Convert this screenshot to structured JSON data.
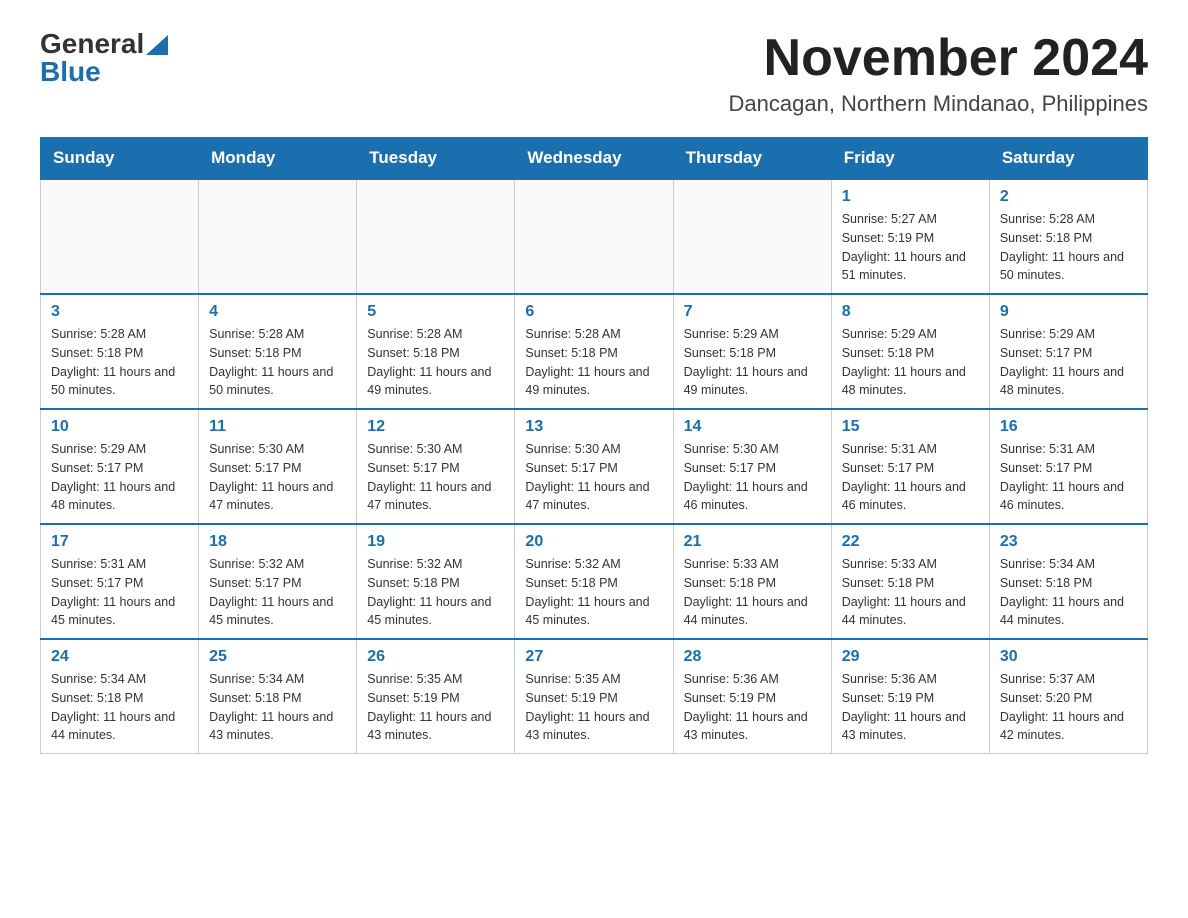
{
  "logo": {
    "general": "General",
    "blue": "Blue"
  },
  "title": {
    "month_year": "November 2024",
    "location": "Dancagan, Northern Mindanao, Philippines"
  },
  "days_of_week": [
    "Sunday",
    "Monday",
    "Tuesday",
    "Wednesday",
    "Thursday",
    "Friday",
    "Saturday"
  ],
  "weeks": [
    [
      {
        "day": "",
        "sunrise": "",
        "sunset": "",
        "daylight": ""
      },
      {
        "day": "",
        "sunrise": "",
        "sunset": "",
        "daylight": ""
      },
      {
        "day": "",
        "sunrise": "",
        "sunset": "",
        "daylight": ""
      },
      {
        "day": "",
        "sunrise": "",
        "sunset": "",
        "daylight": ""
      },
      {
        "day": "",
        "sunrise": "",
        "sunset": "",
        "daylight": ""
      },
      {
        "day": "1",
        "sunrise": "Sunrise: 5:27 AM",
        "sunset": "Sunset: 5:19 PM",
        "daylight": "Daylight: 11 hours and 51 minutes."
      },
      {
        "day": "2",
        "sunrise": "Sunrise: 5:28 AM",
        "sunset": "Sunset: 5:18 PM",
        "daylight": "Daylight: 11 hours and 50 minutes."
      }
    ],
    [
      {
        "day": "3",
        "sunrise": "Sunrise: 5:28 AM",
        "sunset": "Sunset: 5:18 PM",
        "daylight": "Daylight: 11 hours and 50 minutes."
      },
      {
        "day": "4",
        "sunrise": "Sunrise: 5:28 AM",
        "sunset": "Sunset: 5:18 PM",
        "daylight": "Daylight: 11 hours and 50 minutes."
      },
      {
        "day": "5",
        "sunrise": "Sunrise: 5:28 AM",
        "sunset": "Sunset: 5:18 PM",
        "daylight": "Daylight: 11 hours and 49 minutes."
      },
      {
        "day": "6",
        "sunrise": "Sunrise: 5:28 AM",
        "sunset": "Sunset: 5:18 PM",
        "daylight": "Daylight: 11 hours and 49 minutes."
      },
      {
        "day": "7",
        "sunrise": "Sunrise: 5:29 AM",
        "sunset": "Sunset: 5:18 PM",
        "daylight": "Daylight: 11 hours and 49 minutes."
      },
      {
        "day": "8",
        "sunrise": "Sunrise: 5:29 AM",
        "sunset": "Sunset: 5:18 PM",
        "daylight": "Daylight: 11 hours and 48 minutes."
      },
      {
        "day": "9",
        "sunrise": "Sunrise: 5:29 AM",
        "sunset": "Sunset: 5:17 PM",
        "daylight": "Daylight: 11 hours and 48 minutes."
      }
    ],
    [
      {
        "day": "10",
        "sunrise": "Sunrise: 5:29 AM",
        "sunset": "Sunset: 5:17 PM",
        "daylight": "Daylight: 11 hours and 48 minutes."
      },
      {
        "day": "11",
        "sunrise": "Sunrise: 5:30 AM",
        "sunset": "Sunset: 5:17 PM",
        "daylight": "Daylight: 11 hours and 47 minutes."
      },
      {
        "day": "12",
        "sunrise": "Sunrise: 5:30 AM",
        "sunset": "Sunset: 5:17 PM",
        "daylight": "Daylight: 11 hours and 47 minutes."
      },
      {
        "day": "13",
        "sunrise": "Sunrise: 5:30 AM",
        "sunset": "Sunset: 5:17 PM",
        "daylight": "Daylight: 11 hours and 47 minutes."
      },
      {
        "day": "14",
        "sunrise": "Sunrise: 5:30 AM",
        "sunset": "Sunset: 5:17 PM",
        "daylight": "Daylight: 11 hours and 46 minutes."
      },
      {
        "day": "15",
        "sunrise": "Sunrise: 5:31 AM",
        "sunset": "Sunset: 5:17 PM",
        "daylight": "Daylight: 11 hours and 46 minutes."
      },
      {
        "day": "16",
        "sunrise": "Sunrise: 5:31 AM",
        "sunset": "Sunset: 5:17 PM",
        "daylight": "Daylight: 11 hours and 46 minutes."
      }
    ],
    [
      {
        "day": "17",
        "sunrise": "Sunrise: 5:31 AM",
        "sunset": "Sunset: 5:17 PM",
        "daylight": "Daylight: 11 hours and 45 minutes."
      },
      {
        "day": "18",
        "sunrise": "Sunrise: 5:32 AM",
        "sunset": "Sunset: 5:17 PM",
        "daylight": "Daylight: 11 hours and 45 minutes."
      },
      {
        "day": "19",
        "sunrise": "Sunrise: 5:32 AM",
        "sunset": "Sunset: 5:18 PM",
        "daylight": "Daylight: 11 hours and 45 minutes."
      },
      {
        "day": "20",
        "sunrise": "Sunrise: 5:32 AM",
        "sunset": "Sunset: 5:18 PM",
        "daylight": "Daylight: 11 hours and 45 minutes."
      },
      {
        "day": "21",
        "sunrise": "Sunrise: 5:33 AM",
        "sunset": "Sunset: 5:18 PM",
        "daylight": "Daylight: 11 hours and 44 minutes."
      },
      {
        "day": "22",
        "sunrise": "Sunrise: 5:33 AM",
        "sunset": "Sunset: 5:18 PM",
        "daylight": "Daylight: 11 hours and 44 minutes."
      },
      {
        "day": "23",
        "sunrise": "Sunrise: 5:34 AM",
        "sunset": "Sunset: 5:18 PM",
        "daylight": "Daylight: 11 hours and 44 minutes."
      }
    ],
    [
      {
        "day": "24",
        "sunrise": "Sunrise: 5:34 AM",
        "sunset": "Sunset: 5:18 PM",
        "daylight": "Daylight: 11 hours and 44 minutes."
      },
      {
        "day": "25",
        "sunrise": "Sunrise: 5:34 AM",
        "sunset": "Sunset: 5:18 PM",
        "daylight": "Daylight: 11 hours and 43 minutes."
      },
      {
        "day": "26",
        "sunrise": "Sunrise: 5:35 AM",
        "sunset": "Sunset: 5:19 PM",
        "daylight": "Daylight: 11 hours and 43 minutes."
      },
      {
        "day": "27",
        "sunrise": "Sunrise: 5:35 AM",
        "sunset": "Sunset: 5:19 PM",
        "daylight": "Daylight: 11 hours and 43 minutes."
      },
      {
        "day": "28",
        "sunrise": "Sunrise: 5:36 AM",
        "sunset": "Sunset: 5:19 PM",
        "daylight": "Daylight: 11 hours and 43 minutes."
      },
      {
        "day": "29",
        "sunrise": "Sunrise: 5:36 AM",
        "sunset": "Sunset: 5:19 PM",
        "daylight": "Daylight: 11 hours and 43 minutes."
      },
      {
        "day": "30",
        "sunrise": "Sunrise: 5:37 AM",
        "sunset": "Sunset: 5:20 PM",
        "daylight": "Daylight: 11 hours and 42 minutes."
      }
    ]
  ]
}
